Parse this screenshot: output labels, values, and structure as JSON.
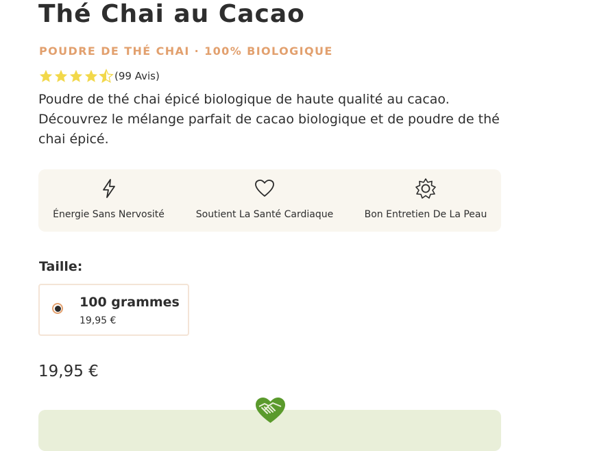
{
  "product": {
    "title": "Thé Chai au Cacao",
    "subtitle": "POUDRE DE THÉ CHAI · 100% BIOLOGIQUE",
    "rating": 4.5,
    "rating_max": 5,
    "reviews": "(99 Avis)",
    "description": "Poudre de thé chai épicé biologique de haute qualité au cacao. Découvrez le mélange parfait de cacao biologique et de poudre de thé chai épicé."
  },
  "benefits": [
    {
      "icon": "lightning-icon",
      "label": "Énergie Sans Nervosité"
    },
    {
      "icon": "heart-icon",
      "label": "Soutient La Santé Cardiaque"
    },
    {
      "icon": "sun-icon",
      "label": "Bon Entretien De La Peau"
    }
  ],
  "size": {
    "label": "Taille:",
    "options": [
      {
        "name": "100 grammes",
        "price": "19,95 €",
        "selected": true
      }
    ]
  },
  "price": "19,95 €",
  "footer_card": {
    "icon": "handshake-heart-icon",
    "text": ""
  },
  "colors": {
    "accent": "#e2a06e",
    "benefits_bg": "#f9f6ef",
    "star": "#f2d84a",
    "green": "#5a9a2c",
    "card_bg": "#e9efd9"
  }
}
